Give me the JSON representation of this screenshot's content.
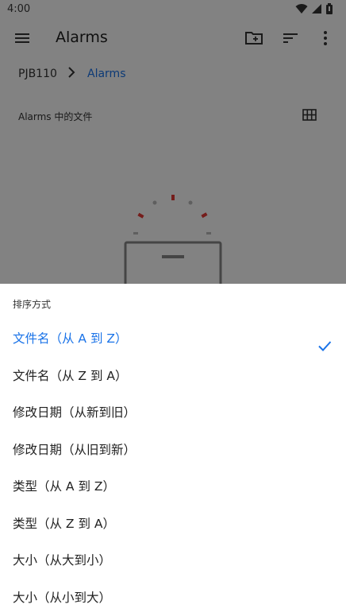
{
  "status_bar": {
    "time": "4:00"
  },
  "app_bar": {
    "title": "Alarms",
    "icons": [
      "menu-icon",
      "new-folder-icon",
      "sort-icon",
      "more-vert-icon"
    ]
  },
  "breadcrumb": {
    "items": [
      "PJB110",
      "Alarms"
    ]
  },
  "folder": {
    "label": "Alarms 中的文件"
  },
  "sort_sheet": {
    "title": "排序方式",
    "selected_index": 0,
    "options": [
      {
        "label": "文件名（从 A 到 Z）"
      },
      {
        "label": "文件名（从 Z 到 A）"
      },
      {
        "label": "修改日期（从新到旧）"
      },
      {
        "label": "修改日期（从旧到新）"
      },
      {
        "label": "类型（从 A 到 Z）"
      },
      {
        "label": "类型（从 Z 到 A）"
      },
      {
        "label": "大小（从大到小）"
      },
      {
        "label": "大小（从小到大）"
      }
    ]
  },
  "colors": {
    "accent": "#1a73e8",
    "scrim": "rgba(0,0,0,0.49)"
  }
}
